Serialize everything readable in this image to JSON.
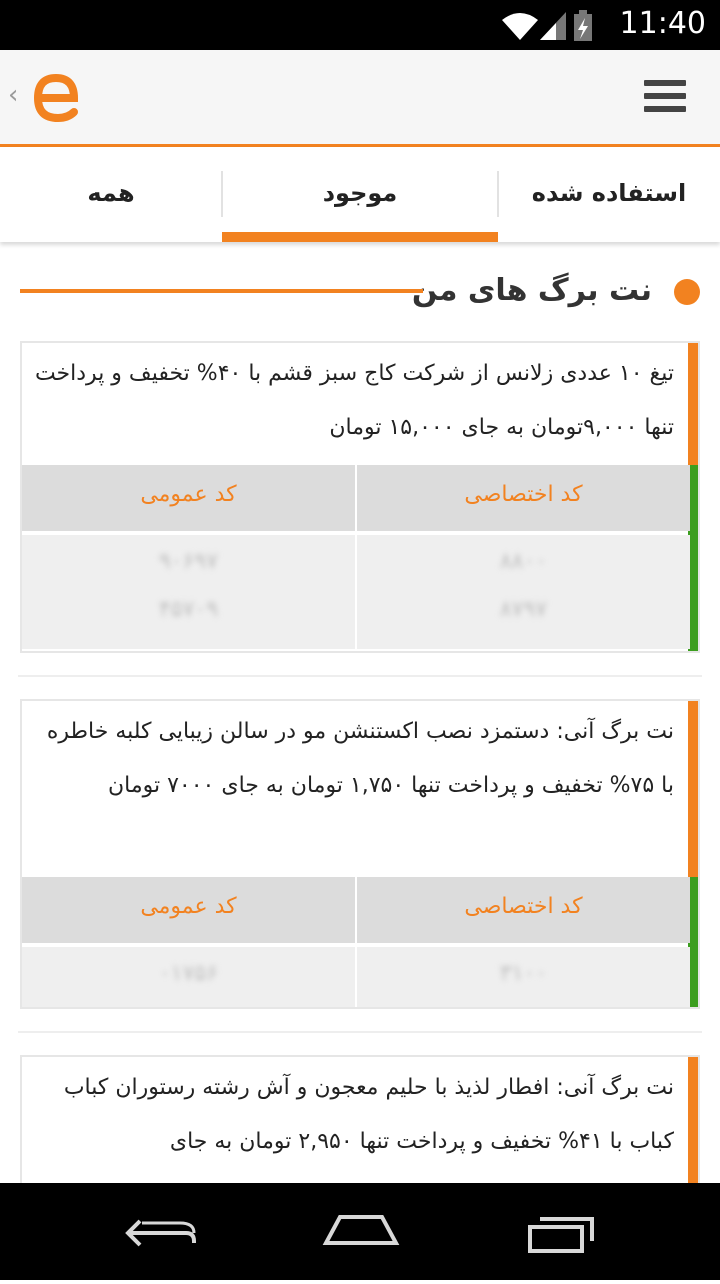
{
  "status_bar": {
    "time": "11:40"
  },
  "app_bar": {
    "logo_letter": "e",
    "back_glyph": "‹"
  },
  "tabs": [
    {
      "label": "همه"
    },
    {
      "label": "موجود"
    },
    {
      "label": "استفاده شده"
    }
  ],
  "section": {
    "title": "نت برگ های من"
  },
  "cards": [
    {
      "description": "تیغ ۱۰ عددی زلانس از شرکت کاج سبز قشم با ۴۰% تخفیف و پرداخت تنها  ۹,۰۰۰تومان به جای ۱۵,۰۰۰ تومان",
      "private_code_label": "کد اختصاصی",
      "public_code_label": "کد عمومی",
      "private_codes": [
        "۸۸۰۰",
        "۸۷۹۷"
      ],
      "public_codes": [
        "۹۰۶۹۷",
        "۴۵۷۰۹"
      ]
    },
    {
      "description": "نت برگ آنی: دستمزد نصب اکستنشن مو در سالن زیبایی کلبه خاطره با ۷۵% تخفیف و پرداخت تنها ۱,۷۵۰ تومان به جای ۷۰۰۰ تومان",
      "private_code_label": "کد اختصاصی",
      "public_code_label": "کد عمومی",
      "private_codes": [
        "۳۱۰۰"
      ],
      "public_codes": [
        "۰۱۷۵۶"
      ]
    },
    {
      "description": "نت برگ آنی: افطار لذیذ با حلیم معجون و آش رشته رستوران کباب کباب با ۴۱% تخفیف و پرداخت تنها ۲,۹۵۰ تومان به جای"
    }
  ],
  "colors": {
    "accent": "#f28220",
    "stripe_green": "#3c9e1f",
    "header_gray": "#dcdcdc"
  }
}
